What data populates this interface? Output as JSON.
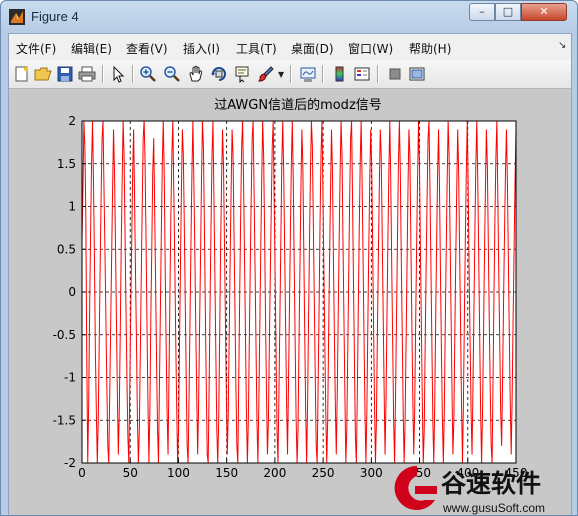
{
  "window": {
    "title": "Figure 4",
    "controls": {
      "minimize": "–",
      "maximize": "□",
      "close": "✕"
    }
  },
  "menu": {
    "items": [
      "文件(F)",
      "编辑(E)",
      "查看(V)",
      "插入(I)",
      "工具(T)",
      "桌面(D)",
      "窗口(W)",
      "帮助(H)"
    ],
    "overflow_icon": "chevron-icon"
  },
  "toolbar": {
    "buttons": [
      "new-figure-icon",
      "open-icon",
      "save-icon",
      "print-icon",
      "edit-plot-icon",
      "zoom-in-icon",
      "zoom-out-icon",
      "pan-icon",
      "rotate-3d-icon",
      "data-cursor-icon",
      "brush-icon",
      "link-icon",
      "colorbar-icon",
      "legend-icon",
      "hide-plot-tools-icon",
      "show-plot-tools-icon"
    ]
  },
  "colors": {
    "signal": "#ff0000",
    "axes_bg": "#ffffff",
    "figure_bg": "#c8c8c8"
  },
  "chart_data": {
    "type": "line",
    "title": "过AWGN信道后的modz信号",
    "xlabel": "",
    "ylabel": "",
    "xlim": [
      0,
      450
    ],
    "ylim": [
      -2,
      2
    ],
    "xticks": [
      0,
      50,
      100,
      150,
      200,
      250,
      300,
      350,
      400,
      450
    ],
    "xtick_labels": [
      "0",
      "50",
      "100",
      "150",
      "200",
      "250",
      "300",
      "350",
      "400",
      "450"
    ],
    "yticks": [
      -2,
      -1.5,
      -1,
      -0.5,
      0,
      0.5,
      1,
      1.5,
      2
    ],
    "ytick_labels": [
      "-2",
      "-1.5",
      "-1",
      "-0.5",
      "0",
      "0.5",
      "1",
      "1.5",
      "2"
    ],
    "grid": true,
    "grid_style": "dashed",
    "series": [
      {
        "color": "#ff0000",
        "y": [
          0.6,
          1.2,
          2,
          1.7,
          0.9,
          -0.8,
          -2,
          -1.3,
          -0.2,
          0.7,
          1.5,
          2,
          1.3,
          0.4,
          -0.7,
          -1.4,
          -2,
          -1.5,
          -0.6,
          0.3,
          1.1,
          1.8,
          2,
          1.2,
          0.5,
          -0.3,
          -1.1,
          -1.8,
          -2,
          -1.2,
          -0.4,
          0.4,
          1.2,
          1.9,
          1.4,
          0.6,
          -0.3,
          -1.2,
          -1.9,
          -1.4,
          -0.5,
          0.5,
          1.3,
          2,
          1.6,
          0.7,
          -0.2,
          -1.0,
          -1.7,
          -2,
          -1.1,
          -0.2,
          0.6,
          1.4,
          1.9,
          1.1,
          0.2,
          -0.6,
          -1.5,
          -2,
          -1.6,
          -0.7,
          0.2,
          1.0,
          1.8,
          2,
          1.5,
          0.6,
          -0.4,
          -1.3,
          -2,
          -1.4,
          -0.3,
          0.5,
          1.4,
          1.8,
          1.0,
          0.1,
          -0.8,
          -1.6,
          -2,
          -1.1,
          -0.2,
          0.7,
          1.5,
          2,
          1.4,
          0.3,
          -0.6,
          -1.4,
          -1.9,
          -1.0,
          0.0,
          0.9,
          1.6,
          2,
          1.2,
          0.4,
          -0.5,
          -1.3,
          -2,
          -1.6,
          -0.6,
          0.3,
          1.2,
          1.9,
          1.6,
          0.8,
          -0.1,
          -1.0,
          -1.8,
          -2,
          -1.2,
          -0.3,
          0.6,
          1.4,
          2,
          1.3,
          0.5,
          -0.4,
          -1.2,
          -1.9,
          -1.3,
          -0.4,
          0.4,
          1.3,
          2,
          1.7,
          0.8,
          -0.2,
          -1.1,
          -1.9,
          -2,
          -1.1,
          -0.1,
          0.8,
          1.6,
          2,
          1.1,
          0.2,
          -0.7,
          -1.6,
          -2,
          -1.5,
          -0.5,
          0.5,
          1.3,
          1.9,
          1.5,
          0.6,
          -0.3,
          -1.2,
          -1.9,
          -1.4,
          -0.5,
          0.4,
          1.2,
          1.9,
          1.6,
          0.7,
          -0.2,
          -1.1,
          -1.8,
          -2,
          -1.0,
          0.0,
          0.9,
          1.7,
          2,
          1.3,
          0.4,
          -0.5,
          -1.4,
          -2,
          -1.5,
          -0.6,
          0.3,
          1.1,
          1.8,
          2,
          1.2,
          0.3,
          -0.6,
          -1.5,
          -2,
          -1.3,
          -0.4,
          0.5,
          1.3,
          2,
          1.6,
          0.7,
          -0.3,
          -1.2,
          -1.9,
          -1.5,
          -0.6,
          0.2,
          1.0,
          1.7,
          2,
          1.1,
          0.2,
          -0.7,
          -1.6,
          -2,
          -1.2,
          -0.3,
          0.6,
          1.5,
          2,
          1.4,
          0.5,
          -0.4,
          -1.3,
          -1.9,
          -1.1,
          -0.2,
          0.7,
          1.5,
          2,
          1.3,
          0.3,
          -0.6,
          -1.5,
          -2,
          -1.6,
          -0.6,
          0.3,
          1.2,
          1.9,
          1.5,
          0.5,
          -0.5,
          -1.4,
          -2,
          -1.3,
          -0.3,
          0.6,
          1.4,
          2,
          1.7,
          0.8,
          -0.1,
          -1.0,
          -1.8,
          -2,
          -1.1,
          -0.2,
          0.8,
          1.6,
          2,
          1.2,
          0.3,
          -0.6,
          -1.4,
          -2,
          -1.5,
          -0.5,
          0.4,
          1.2,
          1.9,
          1.4,
          0.4,
          -0.5,
          -1.3,
          -1.9,
          -1.2,
          -0.3,
          0.6,
          1.4,
          2,
          1.6,
          0.6,
          -0.3,
          -1.2,
          -2,
          -1.6,
          -0.7,
          0.2,
          1.1,
          1.8,
          2,
          1.1,
          0.1,
          -0.8,
          -1.7,
          -2,
          -1.2,
          -0.2,
          0.7,
          1.5,
          2,
          1.3,
          0.4,
          -0.5,
          -1.4,
          -2,
          -1.4,
          -0.4,
          0.5,
          1.3,
          1.9,
          1.5,
          0.6,
          -0.4,
          -1.3,
          -2,
          -1.5,
          -0.5,
          0.4,
          1.2,
          1.9,
          1.6,
          0.7,
          -0.2,
          -1.1,
          -1.9,
          -1.3,
          -0.3,
          0.6,
          1.4,
          2,
          1.3,
          0.3,
          -0.6,
          -1.5,
          -2,
          -1.2,
          -0.3,
          0.6,
          1.5,
          2,
          1.4,
          0.4,
          -0.5,
          -1.4,
          -2,
          -1.5,
          -0.6,
          0.3,
          1.2,
          1.9,
          1.6,
          0.6,
          -0.3,
          -1.2,
          -1.9,
          -1.4,
          -0.4,
          0.5,
          1.3,
          2,
          1.5,
          0.5,
          -0.4,
          -1.3,
          -2,
          -1.6,
          -0.6,
          0.3,
          1.1,
          1.8,
          2,
          1.2,
          0.3,
          -0.6,
          -1.5,
          -2,
          -1.3,
          -0.3,
          0.6,
          1.4,
          1.9,
          1.2,
          0.2,
          -0.7,
          -1.5,
          -2,
          -1.4,
          -0.4,
          0.5,
          1.3,
          2,
          1.6,
          0.7,
          -0.2,
          -1.1,
          -1.9,
          -1.5,
          -0.5,
          0.4,
          1.2,
          1.9,
          1.4,
          0.5,
          -0.4,
          -1.3,
          -2,
          -1.3,
          -0.3,
          0.6,
          1.4,
          2,
          1.2,
          0.2,
          -0.6,
          -1.4,
          -1.9,
          -1.1,
          -0.2,
          0.7,
          1.5,
          2,
          1.3,
          0.4,
          -0.5,
          -1.4,
          -2,
          -1.4,
          -0.5,
          0.4,
          1.2,
          1.9,
          1.5,
          0.6,
          -0.3,
          -1.1,
          -1.8,
          -2,
          -1.0,
          0.0,
          0.9,
          1.6,
          2,
          1.1,
          0.2,
          -0.6,
          -1.4,
          -1.8,
          -1.0,
          -0.1,
          0.7,
          1.4,
          1.9,
          1.3,
          0.4,
          -0.5,
          -1.3,
          -1.9,
          -1.2,
          -0.3,
          0.5,
          1.3,
          1.9
        ]
      }
    ]
  },
  "watermark": {
    "brand": "谷速软件",
    "url": "www.gusuSoft.com"
  }
}
